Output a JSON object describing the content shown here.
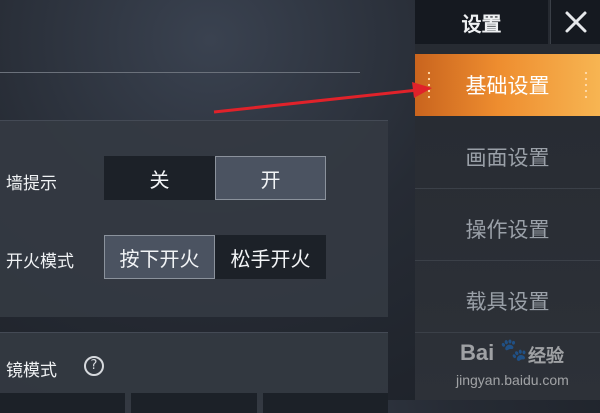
{
  "colors": {
    "accent": "#ee8d2f",
    "arrow": "#e0222a",
    "segment_on": "#4b5361",
    "segment_off": "#1c2128"
  },
  "rows": [
    {
      "label": "墙提示",
      "options": [
        "关",
        "开"
      ],
      "selected": "开"
    },
    {
      "label": "开火模式",
      "options": [
        "按下开火",
        "松手开火"
      ],
      "selected": "按下开火"
    },
    {
      "label": "镜模式"
    }
  ],
  "sidebar": {
    "title": "设置",
    "close_icon": "close-icon",
    "items": [
      {
        "label": "基础设置",
        "active": true
      },
      {
        "label": "画面设置",
        "active": false
      },
      {
        "label": "操作设置",
        "active": false
      },
      {
        "label": "载具设置",
        "active": false
      }
    ]
  },
  "watermark": {
    "brand": "Bai",
    "paw_icon": "paw-icon",
    "text": "经验",
    "url": "jingyan.baidu.com"
  }
}
